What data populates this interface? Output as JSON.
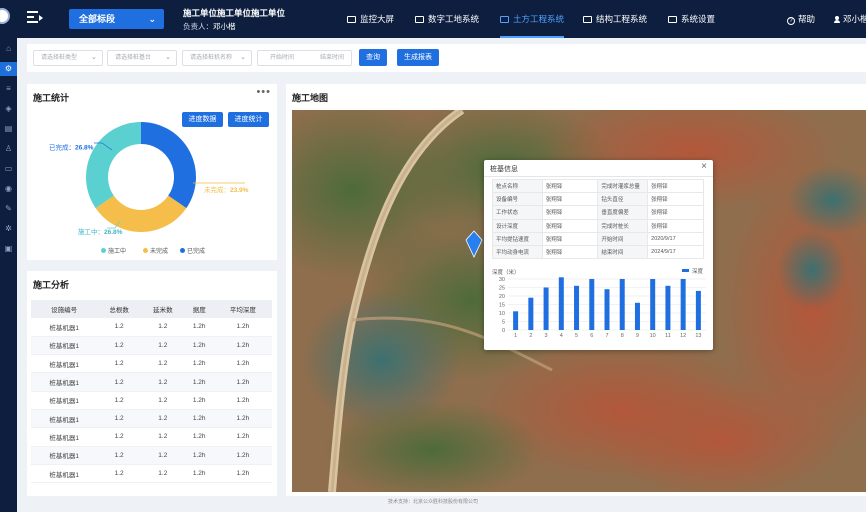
{
  "header": {
    "section_select": "全部标段",
    "unit_title": "施工单位施工单位施工单位",
    "owner_label": "负责人：",
    "owner_name": "邓小楷",
    "nav": [
      {
        "label": "监控大屏",
        "icon": "monitor-icon"
      },
      {
        "label": "数字工地系统",
        "icon": "building-icon"
      },
      {
        "label": "土方工程系统",
        "icon": "excavator-icon",
        "active": true
      },
      {
        "label": "结构工程系统",
        "icon": "structure-icon"
      },
      {
        "label": "系统设置",
        "icon": "settings-icon"
      }
    ],
    "help": "帮助",
    "user": "邓小楷"
  },
  "filters": {
    "type_placeholder": "请选择桩类型",
    "platform_placeholder": "请选择桩基台",
    "machine_placeholder": "请选择桩机名称",
    "start_placeholder": "开始时间",
    "end_placeholder": "结束时间",
    "query_button": "查询",
    "report_button": "生成报表"
  },
  "stats": {
    "title": "施工统计",
    "more": "•••",
    "progress_data_button": "进度数据",
    "progress_stats_button": "进度统计",
    "label_done": "已完成：",
    "label_undone": "未完成：",
    "label_doing": "施工中：",
    "legend": [
      "施工中",
      "未完成",
      "已完成"
    ],
    "colors": {
      "doing": "#5bd0d0",
      "undone": "#f5bd4a",
      "done": "#1f6fe0"
    }
  },
  "chart_data": [
    {
      "type": "pie",
      "categories": [
        "已完成",
        "未完成",
        "施工中"
      ],
      "values": [
        26.8,
        23.9,
        26.8
      ],
      "labels": [
        "26.8%",
        "23.9%",
        "26.8%"
      ],
      "legend_position": "bottom",
      "colors": [
        "#1f6fe0",
        "#f5bd4a",
        "#5bd0d0"
      ]
    },
    {
      "type": "bar",
      "ylabel": "深度（米）",
      "legend": "深度",
      "categories": [
        "1",
        "2",
        "3",
        "4",
        "5",
        "6",
        "7",
        "8",
        "9",
        "10",
        "11",
        "12",
        "13"
      ],
      "values": [
        11,
        19,
        25,
        31,
        26,
        30,
        24,
        30,
        16,
        30,
        26,
        30,
        23
      ],
      "yticks": [
        "0",
        "5",
        "10",
        "15",
        "20",
        "25",
        "30"
      ],
      "ylim": [
        0,
        30
      ],
      "grid": true
    }
  ],
  "analysis": {
    "title": "施工分析",
    "columns": [
      "设施编号",
      "总根数",
      "延米数",
      "据度",
      "平均深度"
    ],
    "rows": [
      [
        "桩基机器1",
        "1.2",
        "1.2",
        "1.2h",
        "1.2h"
      ],
      [
        "桩基机器1",
        "1.2",
        "1.2",
        "1.2h",
        "1.2h"
      ],
      [
        "桩基机器1",
        "1.2",
        "1.2",
        "1.2h",
        "1.2h"
      ],
      [
        "桩基机器1",
        "1.2",
        "1.2",
        "1.2h",
        "1.2h"
      ],
      [
        "桩基机器1",
        "1.2",
        "1.2",
        "1.2h",
        "1.2h"
      ],
      [
        "桩基机器1",
        "1.2",
        "1.2",
        "1.2h",
        "1.2h"
      ],
      [
        "桩基机器1",
        "1.2",
        "1.2",
        "1.2h",
        "1.2h"
      ],
      [
        "桩基机器1",
        "1.2",
        "1.2",
        "1.2h",
        "1.2h"
      ],
      [
        "桩基机器1",
        "1.2",
        "1.2",
        "1.2h",
        "1.2h"
      ]
    ]
  },
  "map": {
    "title": "施工地图",
    "popup": {
      "title": "桩基信息",
      "close": "×",
      "fields": [
        [
          "桩点名称",
          "张翔铎",
          "完成时灌浆总量",
          "张翔铎"
        ],
        [
          "设备编号",
          "张翔铎",
          "钻头直径",
          "张翔铎"
        ],
        [
          "工作状态",
          "张翔铎",
          "垂直度偏差",
          "张翔铎"
        ],
        [
          "设计深度",
          "张翔铎",
          "完成时桩长",
          "张翔铎"
        ],
        [
          "平均提钻速度",
          "张翔铎",
          "开始时间",
          "2020/9/17"
        ],
        [
          "平均动身电流",
          "张翔铎",
          "结束时间",
          "2024/9/17"
        ]
      ]
    }
  },
  "footer": "技术支持：北京公众胜科技股份有限公司"
}
